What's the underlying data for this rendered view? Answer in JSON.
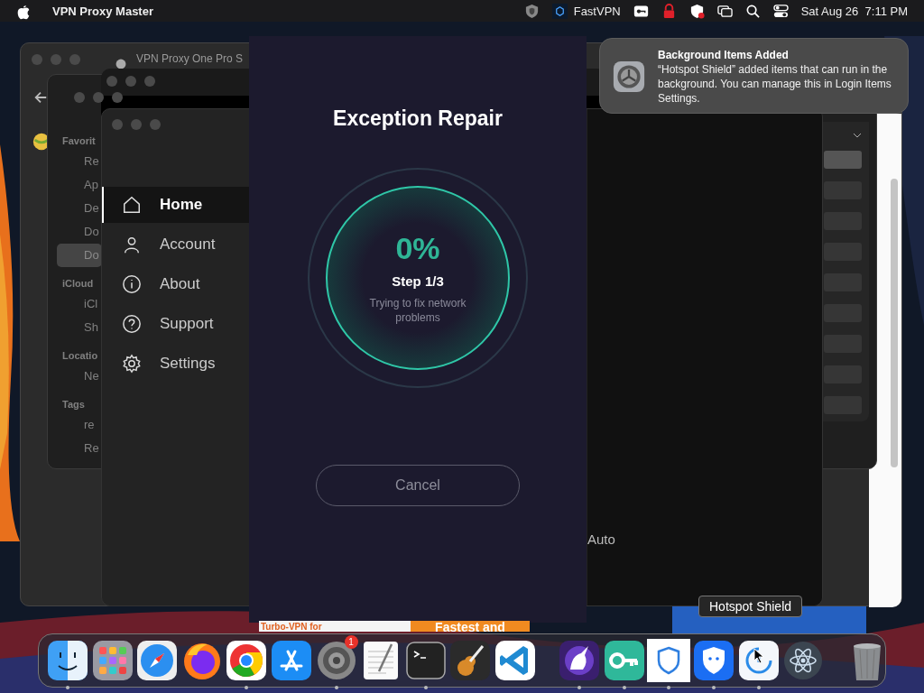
{
  "menu_bar": {
    "app_name": "VPN Proxy Master",
    "vpn_label": "FastVPN",
    "clock": "Sat Aug 26  7:11 PM"
  },
  "proxy_window": {
    "title": "VPN Proxy One Pro S"
  },
  "finder_window": {
    "sections": [
      {
        "heading": "Favorit",
        "items": [
          {
            "label": "Re",
            "selected": false
          },
          {
            "label": "Ap",
            "selected": false
          },
          {
            "label": "De",
            "selected": false
          },
          {
            "label": "Do",
            "selected": false
          },
          {
            "label": "Do",
            "selected": true
          }
        ]
      },
      {
        "heading": "iCloud",
        "items": [
          {
            "label": "iCl",
            "selected": false
          },
          {
            "label": "Sh",
            "selected": false
          }
        ]
      },
      {
        "heading": "Locatio",
        "items": [
          {
            "label": "Ne",
            "selected": false
          }
        ]
      },
      {
        "heading": "Tags",
        "items": [
          {
            "label": "re",
            "selected": false
          },
          {
            "label": "Re",
            "selected": false
          }
        ]
      }
    ],
    "list_rows": [
      {
        "selected": true
      },
      {
        "selected": false
      },
      {
        "selected": false
      },
      {
        "selected": false
      },
      {
        "selected": false
      },
      {
        "selected": false
      },
      {
        "selected": false
      },
      {
        "selected": false
      },
      {
        "selected": false
      }
    ]
  },
  "app_menu": {
    "items": [
      {
        "kind": "home",
        "label": "Home",
        "selected": true
      },
      {
        "kind": "account",
        "label": "Account",
        "selected": false
      },
      {
        "kind": "about",
        "label": "About",
        "selected": false
      },
      {
        "kind": "support",
        "label": "Support",
        "selected": false
      },
      {
        "kind": "settings",
        "label": "Settings",
        "selected": false
      }
    ],
    "side_text": "Auto"
  },
  "repair_dialog": {
    "title": "Exception Repair",
    "percent": "0%",
    "step": "Step 1/3",
    "message": "Trying to fix network problems",
    "cancel": "Cancel"
  },
  "ads": [
    "Turbo-VPN for",
    "Fastest and"
  ],
  "notification": {
    "title": "Background Items Added",
    "body": "“Hotspot Shield” added items that can run in the background. You can manage this in Login Items Settings."
  },
  "tooltip": "Hotspot Shield",
  "dock": [
    {
      "kind": "finder",
      "running": true
    },
    {
      "kind": "launchpad",
      "running": false
    },
    {
      "kind": "safari",
      "running": false
    },
    {
      "kind": "firefox",
      "running": false
    },
    {
      "kind": "chrome",
      "running": true
    },
    {
      "kind": "appstore",
      "running": false
    },
    {
      "kind": "settings",
      "running": true,
      "badge": "1"
    },
    {
      "kind": "textedit",
      "running": false
    },
    {
      "kind": "terminal",
      "running": true
    },
    {
      "kind": "guitar",
      "running": false
    },
    {
      "kind": "vscode",
      "running": false
    },
    {
      "kind": "separator"
    },
    {
      "kind": "unicorn",
      "running": true
    },
    {
      "kind": "key",
      "running": true
    },
    {
      "kind": "shield-white",
      "running": true
    },
    {
      "kind": "shield-blue",
      "running": true
    },
    {
      "kind": "hotspot",
      "running": true
    },
    {
      "kind": "atom",
      "running": false
    },
    {
      "kind": "separator"
    },
    {
      "kind": "trash",
      "running": false
    }
  ]
}
